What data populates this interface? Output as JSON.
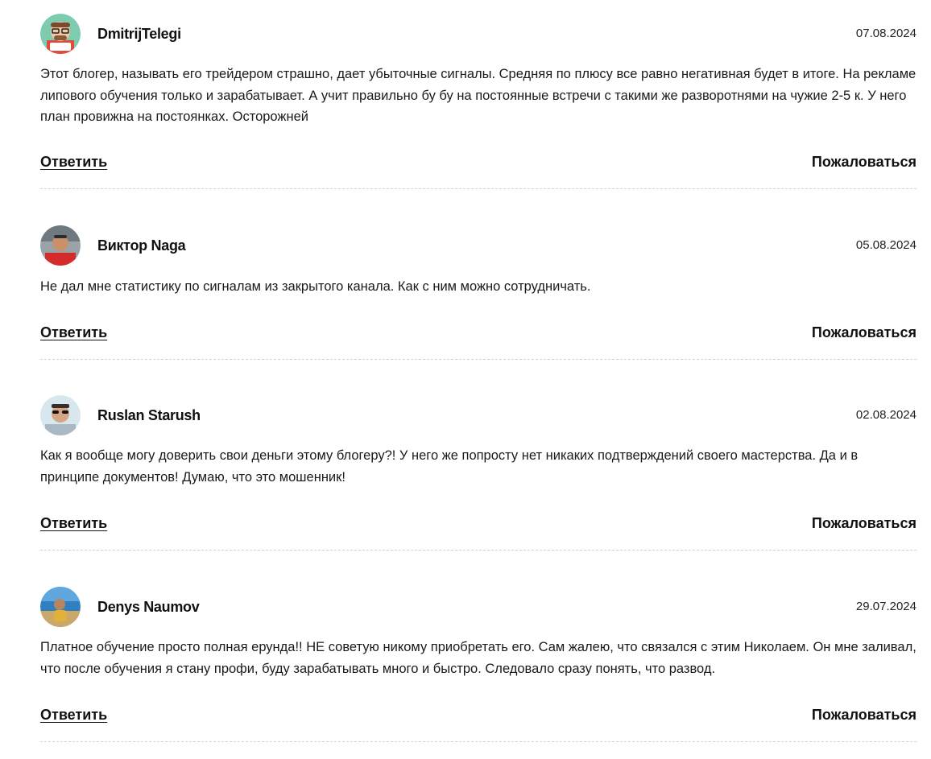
{
  "comments": [
    {
      "author": "DmitrijTelegi",
      "date": "07.08.2024",
      "text": "Этот блогер, называть его трейдером страшно, дает убыточные сигналы. Средняя по плюсу все равно негативная будет в итоге. На рекламе липового обучения только и зарабатывает. А учит правильно бу бу на постоянные встречи с такими же разворотнями на чужие 2-5 к. У него план провижна на постоянках. Осторожней",
      "reply_label": "Ответить",
      "report_label": "Пожаловаться",
      "avatar": "cartoon-avatar"
    },
    {
      "author": "Виктор Naga",
      "date": "05.08.2024",
      "text": "Не дал мне статистику по сигналам из закрытого канала. Как с ним можно сотрудничать.",
      "reply_label": "Ответить",
      "report_label": "Пожаловаться",
      "avatar": "photo-avatar"
    },
    {
      "author": "Ruslan Starush",
      "date": "02.08.2024",
      "text": "Как я вообще могу доверить свои деньги этому блогеру?! У него же попросту нет никаких подтверждений своего мастерства. Да и в принципе документов! Думаю, что это мошенник!",
      "reply_label": "Ответить",
      "report_label": "Пожаловаться",
      "avatar": "photo-avatar"
    },
    {
      "author": "Denys Naumov",
      "date": "29.07.2024",
      "text": "Платное обучение просто полная ерунда!! НЕ советую никому приобретать его. Сам жалею, что связался с этим Николаем. Он мне заливал, что после обучения я стану профи, буду зарабатывать много и быстро. Следовало сразу понять, что развод.",
      "reply_label": "Ответить",
      "report_label": "Пожаловаться",
      "avatar": "photo-avatar"
    }
  ]
}
